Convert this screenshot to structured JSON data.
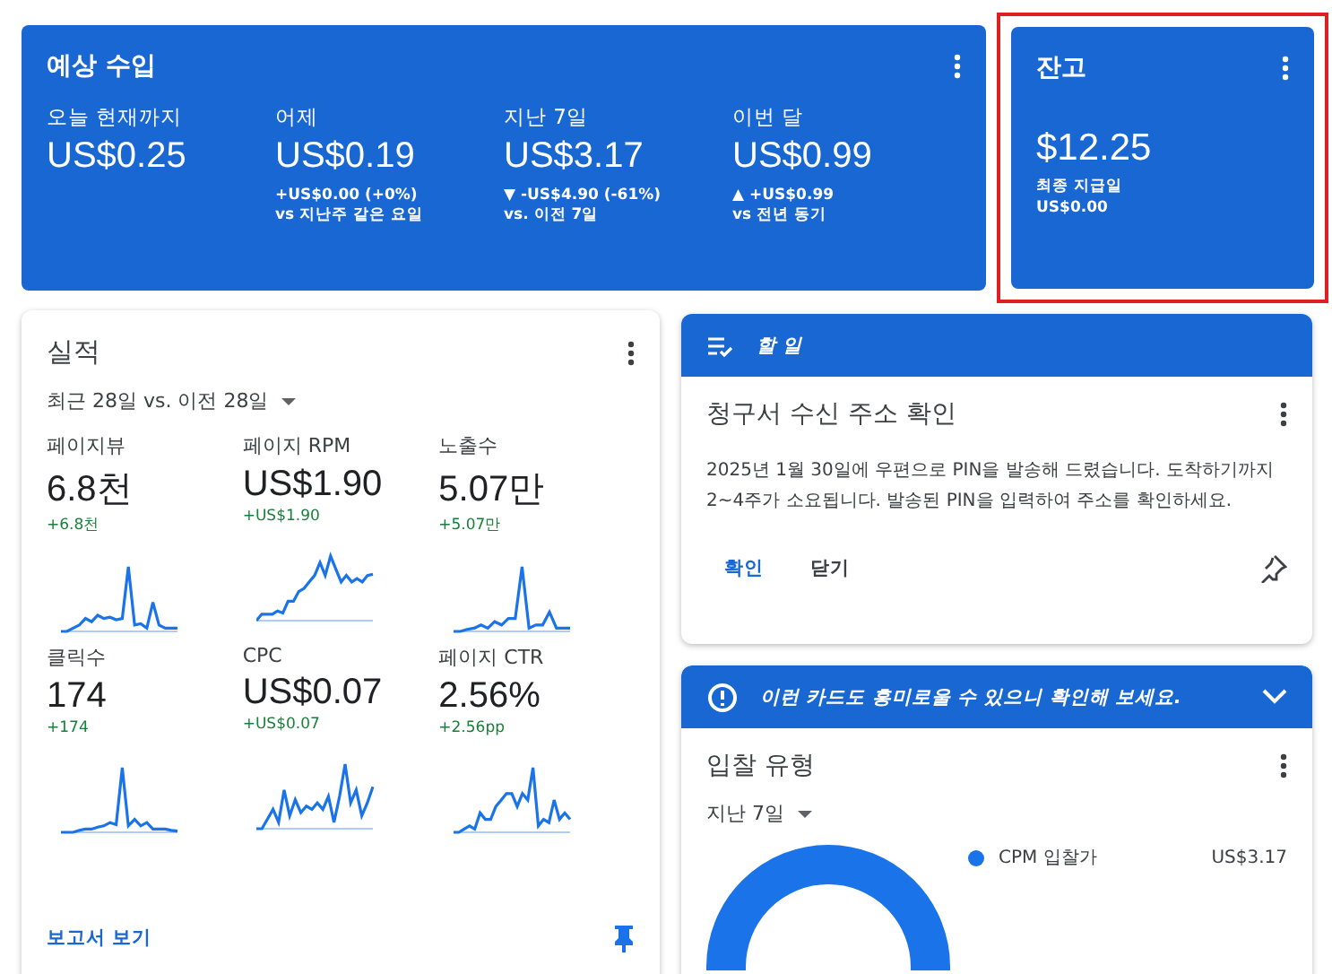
{
  "earnings": {
    "title": "예상 수입",
    "items": [
      {
        "label": "오늘 현재까지",
        "value": "US$0.25"
      },
      {
        "label": "어제",
        "value": "US$0.19",
        "change": "+US$0.00 (+0%)",
        "compare": "vs 지난주 같은 요일"
      },
      {
        "label": "지난 7일",
        "value": "US$3.17",
        "change": "▼ -US$4.90 (-61%)",
        "compare": "vs. 이전 7일"
      },
      {
        "label": "이번 달",
        "value": "US$0.99",
        "change": "▲ +US$0.99",
        "compare": "vs 전년 동기"
      }
    ]
  },
  "balance": {
    "title": "잔고",
    "value": "$12.25",
    "last_payment_label": "최종 지급일",
    "last_payment": "US$0.00",
    "highlighted": true
  },
  "performance": {
    "title": "실적",
    "period": "최근 28일 vs. 이전 28일",
    "link": "보고서 보기",
    "metrics": [
      {
        "label": "페이지뷰",
        "value": "6.8천",
        "change": "+6.8천"
      },
      {
        "label": "페이지 RPM",
        "value": "US$1.90",
        "change": "+US$1.90"
      },
      {
        "label": "노출수",
        "value": "5.07만",
        "change": "+5.07만"
      },
      {
        "label": "클릭수",
        "value": "174",
        "change": "+174"
      },
      {
        "label": "CPC",
        "value": "US$0.07",
        "change": "+US$0.07"
      },
      {
        "label": "페이지 CTR",
        "value": "2.56%",
        "change": "+2.56pp"
      }
    ]
  },
  "todo": {
    "header": "할 일",
    "title": "청구서 수신 주소 확인",
    "body": "2025년 1월 30일에 우편으로 PIN을 발송해 드렸습니다. 도착하기까지 2~4주가 소요됩니다. 발송된 PIN을 입력하여 주소를 확인하세요.",
    "actions": [
      "확인",
      "닫기"
    ]
  },
  "suggestion": {
    "text": "이런 카드도 흥미로울 수 있으니 확인해 보세요.",
    "expanded": false
  },
  "bid_types": {
    "title": "입찰 유형",
    "period": "지난 7일",
    "legend": [
      {
        "label": "CPM 입찰가",
        "value": "US$3.17",
        "color": "#1a73e8"
      }
    ]
  }
}
